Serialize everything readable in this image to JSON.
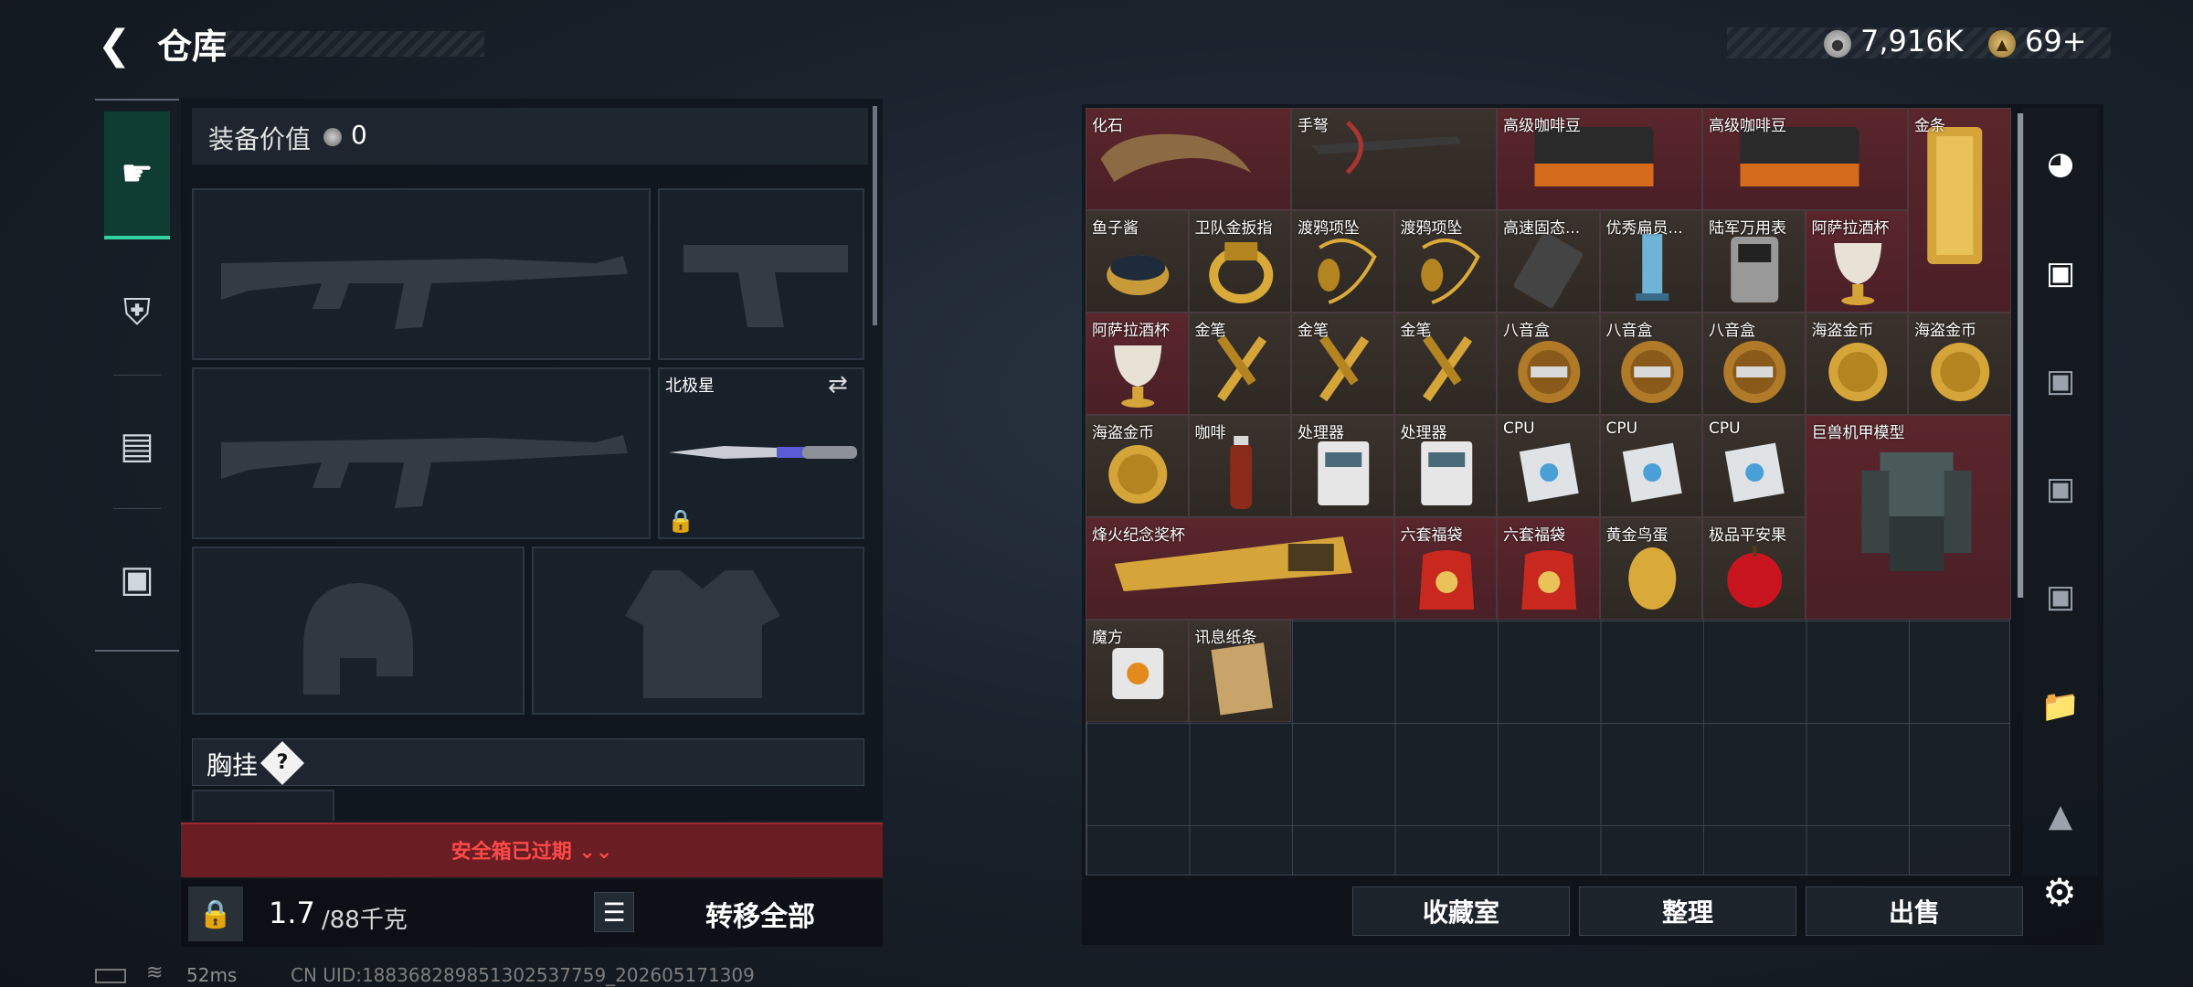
{
  "header": {
    "title": "仓库",
    "currency_value": "7,916K",
    "tickets_value": "69+",
    "back_icon": "back-arrow-icon"
  },
  "equipment": {
    "value_label": "装备价值",
    "value_amount": "0",
    "melee_label": "北极星",
    "chest_rig_label": "胸挂",
    "chest_rig_help": "?",
    "safe_box_expired": "安全箱已过期 ⌄⌄",
    "weight_current": "1.7",
    "weight_max": "/88千克",
    "transfer_all": "转移全部"
  },
  "items": [
    {
      "name": "化石",
      "tone": "red",
      "art": "fossil-claw"
    },
    {
      "name": "手弩",
      "tone": "brown",
      "art": "crossbow"
    },
    {
      "name": "高级咖啡豆",
      "tone": "red",
      "art": "coffee-bag"
    },
    {
      "name": "高级咖啡豆",
      "tone": "red",
      "art": "coffee-bag"
    },
    {
      "name": "金条",
      "tone": "red",
      "art": "gold-bar"
    },
    {
      "name": "鱼子酱",
      "tone": "brown",
      "art": "caviar-tin"
    },
    {
      "name": "卫队金扳指",
      "tone": "brown",
      "art": "gold-ring"
    },
    {
      "name": "渡鸦项坠",
      "tone": "brown",
      "art": "raven-pendant"
    },
    {
      "name": "渡鸦项坠",
      "tone": "brown",
      "art": "raven-pendant"
    },
    {
      "name": "高速固态...",
      "tone": "brown",
      "art": "ssd"
    },
    {
      "name": "优秀扁员...",
      "tone": "brown",
      "art": "crystal"
    },
    {
      "name": "陆军万用表",
      "tone": "brown",
      "art": "multimeter"
    },
    {
      "name": "阿萨拉酒杯",
      "tone": "red",
      "art": "goblet"
    },
    {
      "name": "阿萨拉酒杯",
      "tone": "red",
      "art": "goblet"
    },
    {
      "name": "金笔",
      "tone": "brown",
      "art": "gold-pen"
    },
    {
      "name": "金笔",
      "tone": "brown",
      "art": "gold-pen"
    },
    {
      "name": "金笔",
      "tone": "brown",
      "art": "gold-pen"
    },
    {
      "name": "八音盒",
      "tone": "brown",
      "art": "music-box"
    },
    {
      "name": "八音盒",
      "tone": "brown",
      "art": "music-box"
    },
    {
      "name": "八音盒",
      "tone": "brown",
      "art": "music-box"
    },
    {
      "name": "海盗金币",
      "tone": "brown",
      "art": "gold-coin"
    },
    {
      "name": "海盗金币",
      "tone": "brown",
      "art": "gold-coin"
    },
    {
      "name": "海盗金币",
      "tone": "brown",
      "art": "gold-coin"
    },
    {
      "name": "咖啡",
      "tone": "brown",
      "art": "coffee-bottle"
    },
    {
      "name": "处理器",
      "tone": "brown",
      "art": "processor"
    },
    {
      "name": "处理器",
      "tone": "brown",
      "art": "processor"
    },
    {
      "name": "CPU",
      "tone": "brown",
      "art": "cpu"
    },
    {
      "name": "CPU",
      "tone": "brown",
      "art": "cpu"
    },
    {
      "name": "CPU",
      "tone": "brown",
      "art": "cpu"
    },
    {
      "name": "巨兽机甲模型",
      "tone": "red",
      "art": "mech"
    },
    {
      "name": "烽火纪念奖杯",
      "tone": "red",
      "art": "trophy"
    },
    {
      "name": "六套福袋",
      "tone": "red",
      "art": "lucky-bag"
    },
    {
      "name": "六套福袋",
      "tone": "red",
      "art": "lucky-bag"
    },
    {
      "name": "黄金鸟蛋",
      "tone": "brown",
      "art": "golden-egg"
    },
    {
      "name": "极品平安果",
      "tone": "brown",
      "art": "apple"
    },
    {
      "name": "魔方",
      "tone": "brown",
      "art": "cube"
    },
    {
      "name": "讯息纸条",
      "tone": "brown",
      "art": "note"
    }
  ],
  "storage_buttons": {
    "collection": "收藏室",
    "organize": "整理",
    "sell": "出售"
  },
  "status_bar": {
    "ping": "52ms",
    "uid": "CN UID:18836828985130253775​9_202605171309"
  },
  "colors": {
    "accent": "#33d0a0",
    "danger": "#ff4a4a",
    "rare_bg": "#5a262c"
  }
}
